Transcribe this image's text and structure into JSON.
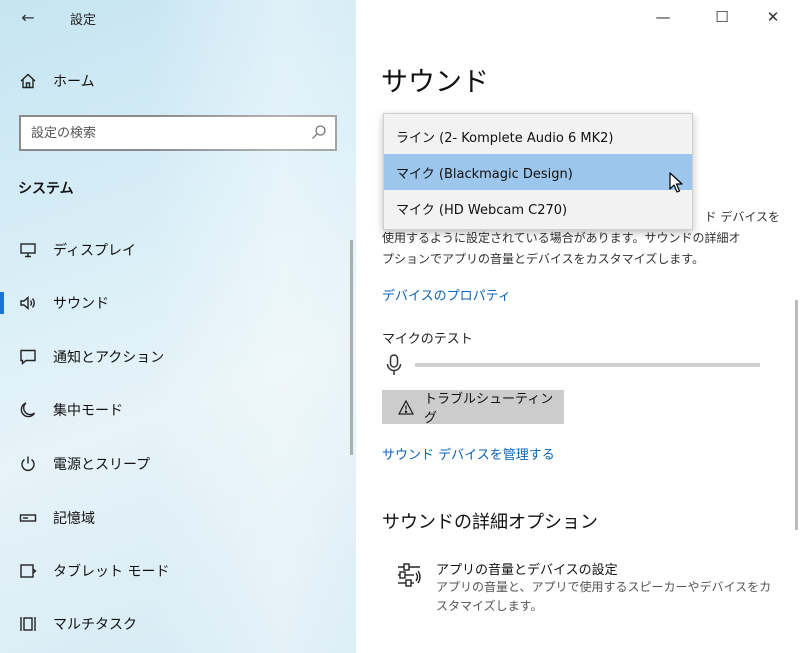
{
  "window": {
    "title": "設定",
    "back_glyph": "←",
    "controls": {
      "minimize": "—",
      "maximize": "☐",
      "close": "✕"
    }
  },
  "sidebar": {
    "home_label": "ホーム",
    "search": {
      "placeholder": "設定の検索",
      "value": ""
    },
    "section_heading": "システム",
    "items": [
      {
        "label": "ディスプレイ",
        "icon": "monitor-icon",
        "active": false
      },
      {
        "label": "サウンド",
        "icon": "speaker-icon",
        "active": true
      },
      {
        "label": "通知とアクション",
        "icon": "notification-icon",
        "active": false
      },
      {
        "label": "集中モード",
        "icon": "moon-icon",
        "active": false
      },
      {
        "label": "電源とスリープ",
        "icon": "power-icon",
        "active": false
      },
      {
        "label": "記憶域",
        "icon": "storage-icon",
        "active": false
      },
      {
        "label": "タブレット モード",
        "icon": "tablet-icon",
        "active": false
      },
      {
        "label": "マルチタスク",
        "icon": "multitask-icon",
        "active": false
      }
    ]
  },
  "main": {
    "title": "サウンド",
    "dropdown_options": [
      {
        "label": "ライン (2- Komplete Audio 6 MK2)",
        "highlighted": false
      },
      {
        "label": "マイク (Blackmagic Design)",
        "highlighted": true
      },
      {
        "label": "マイク (HD Webcam C270)",
        "highlighted": false
      }
    ],
    "desc_line1_fragment": "ド デバイスを",
    "desc_line2": "使用するように設定されている場合があります。サウンドの詳細オ",
    "desc_line3": "プションでアプリの音量とデバイスをカスタマイズします。",
    "device_properties_link": "デバイスのプロパティ",
    "mic_test_label": "マイクのテスト",
    "mic_level": 0,
    "troubleshoot_button": "トラブルシューティング",
    "manage_devices_link": "サウンド デバイスを管理する",
    "advanced_section_title": "サウンドの詳細オプション",
    "advanced_item": {
      "title": "アプリの音量とデバイスの設定",
      "description": "アプリの音量と、アプリで使用するスピーカーやデバイスをカスタマイズします。"
    }
  },
  "colors": {
    "accent": "#1a73d9",
    "link": "#0a64b8",
    "highlight": "#9cc6ec"
  }
}
